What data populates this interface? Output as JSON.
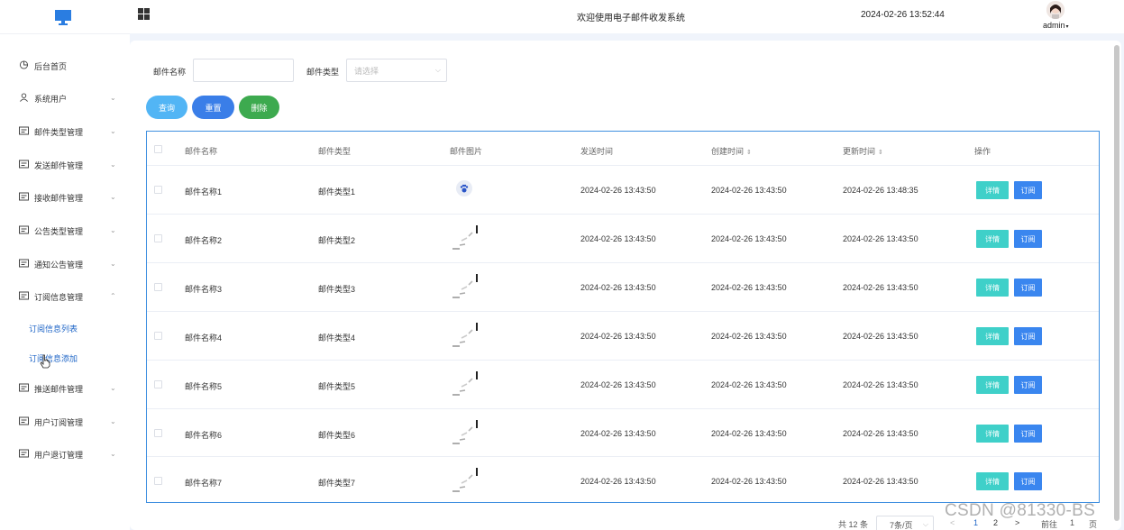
{
  "header": {
    "title": "欢迎使用电子邮件收发系统",
    "datetime": "2024-02-26 13:52:44",
    "username": "admin"
  },
  "sidebar": {
    "items": [
      {
        "label": "后台首页",
        "icon": "home-icon"
      },
      {
        "label": "系统用户",
        "icon": "user-icon"
      },
      {
        "label": "邮件类型管理",
        "icon": "list-icon"
      },
      {
        "label": "发送邮件管理",
        "icon": "list-icon"
      },
      {
        "label": "接收邮件管理",
        "icon": "list-icon"
      },
      {
        "label": "公告类型管理",
        "icon": "list-icon"
      },
      {
        "label": "通知公告管理",
        "icon": "list-icon"
      },
      {
        "label": "订阅信息管理",
        "icon": "list-icon"
      },
      {
        "label": "推送邮件管理",
        "icon": "list-icon"
      },
      {
        "label": "用户订阅管理",
        "icon": "list-icon"
      },
      {
        "label": "用户退订管理",
        "icon": "list-icon"
      }
    ],
    "subitems": [
      {
        "label": "订阅信息列表"
      },
      {
        "label": "订阅信息添加"
      }
    ]
  },
  "search": {
    "name_label": "邮件名称",
    "name_value": "",
    "type_label": "邮件类型",
    "type_placeholder": "请选择"
  },
  "buttons": {
    "query": "查询",
    "reset": "重置",
    "delete": "删除"
  },
  "colors": {
    "query": "#52b5f5",
    "reset": "#3a7ee8",
    "delete": "#3daa4f",
    "detail": "#3fd0c9",
    "subscribe": "#3a86ef",
    "accent": "#1f66c7"
  },
  "table": {
    "headers": {
      "name": "邮件名称",
      "type": "邮件类型",
      "image": "邮件图片",
      "send_time": "发送时间",
      "create_time": "创建时间",
      "update_time": "更新时间",
      "actions": "操作"
    },
    "rows": [
      {
        "name": "邮件名称1",
        "type": "邮件类型1",
        "send": "2024-02-26 13:43:50",
        "create": "2024-02-26 13:43:50",
        "update": "2024-02-26 13:48:35",
        "image": "paw-icon"
      },
      {
        "name": "邮件名称2",
        "type": "邮件类型2",
        "send": "2024-02-26 13:43:50",
        "create": "2024-02-26 13:43:50",
        "update": "2024-02-26 13:43:50",
        "image": "loading-icon"
      },
      {
        "name": "邮件名称3",
        "type": "邮件类型3",
        "send": "2024-02-26 13:43:50",
        "create": "2024-02-26 13:43:50",
        "update": "2024-02-26 13:43:50",
        "image": "loading-icon"
      },
      {
        "name": "邮件名称4",
        "type": "邮件类型4",
        "send": "2024-02-26 13:43:50",
        "create": "2024-02-26 13:43:50",
        "update": "2024-02-26 13:43:50",
        "image": "loading-icon"
      },
      {
        "name": "邮件名称5",
        "type": "邮件类型5",
        "send": "2024-02-26 13:43:50",
        "create": "2024-02-26 13:43:50",
        "update": "2024-02-26 13:43:50",
        "image": "loading-icon"
      },
      {
        "name": "邮件名称6",
        "type": "邮件类型6",
        "send": "2024-02-26 13:43:50",
        "create": "2024-02-26 13:43:50",
        "update": "2024-02-26 13:43:50",
        "image": "loading-icon"
      },
      {
        "name": "邮件名称7",
        "type": "邮件类型7",
        "send": "2024-02-26 13:43:50",
        "create": "2024-02-26 13:43:50",
        "update": "2024-02-26 13:43:50",
        "image": "loading-icon"
      }
    ],
    "detail_label": "详情",
    "subscribe_label": "订阅"
  },
  "pagination": {
    "total": "共 12 条",
    "page_size": "7条/页",
    "pages": [
      "1",
      "2"
    ],
    "goto_prefix": "前往",
    "goto_value": "1",
    "goto_suffix": "页"
  },
  "watermark": "CSDN @81330-BS"
}
